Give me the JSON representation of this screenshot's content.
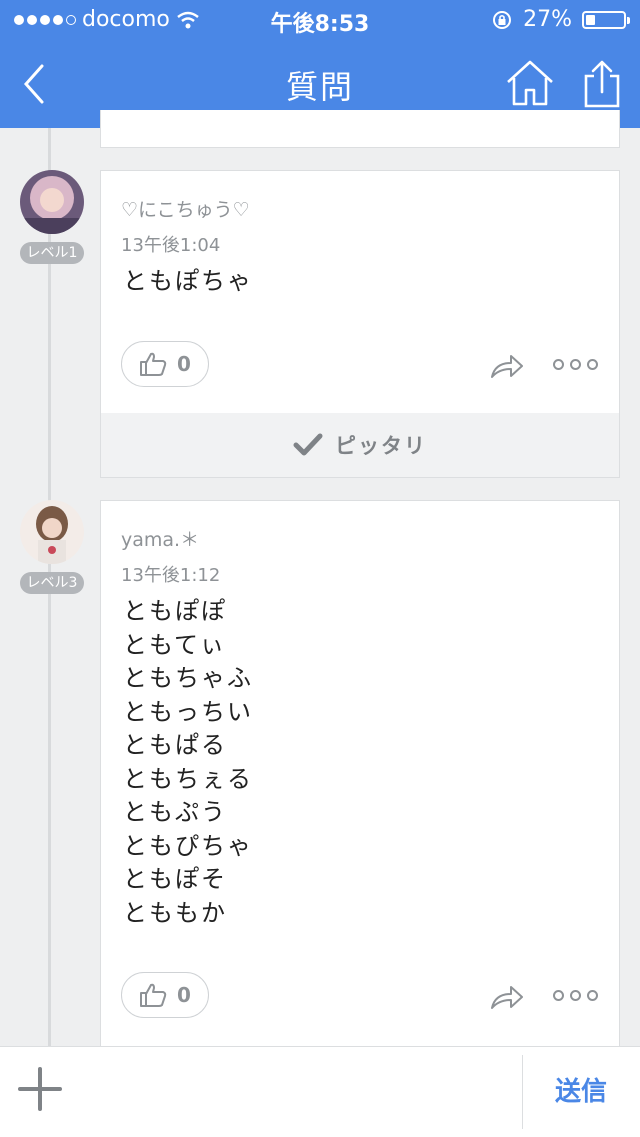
{
  "status_bar": {
    "carrier": "docomo",
    "time": "午後8:53",
    "battery": "27%"
  },
  "nav": {
    "title": "質問"
  },
  "answers": [
    {
      "username": "♡にこちゅう♡",
      "time": "13午後1:04",
      "level": "レベル1",
      "lines": [
        "ともぽちゃ"
      ],
      "likes": "0",
      "best_label": "ピッタリ"
    },
    {
      "username": "yama.＊",
      "time": "13午後1:12",
      "level": "レベル3",
      "lines": [
        "ともぽぽ",
        "ともてぃ",
        "ともちゃふ",
        "ともっちい",
        "ともぱる",
        "ともちぇる",
        "ともぷう",
        "ともぴちゃ",
        "ともぽそ",
        "とももか"
      ],
      "likes": "0"
    }
  ],
  "bottom_bar": {
    "send_label": "送信"
  },
  "colors": {
    "accent": "#4a87e6",
    "background": "#eeeff0"
  }
}
